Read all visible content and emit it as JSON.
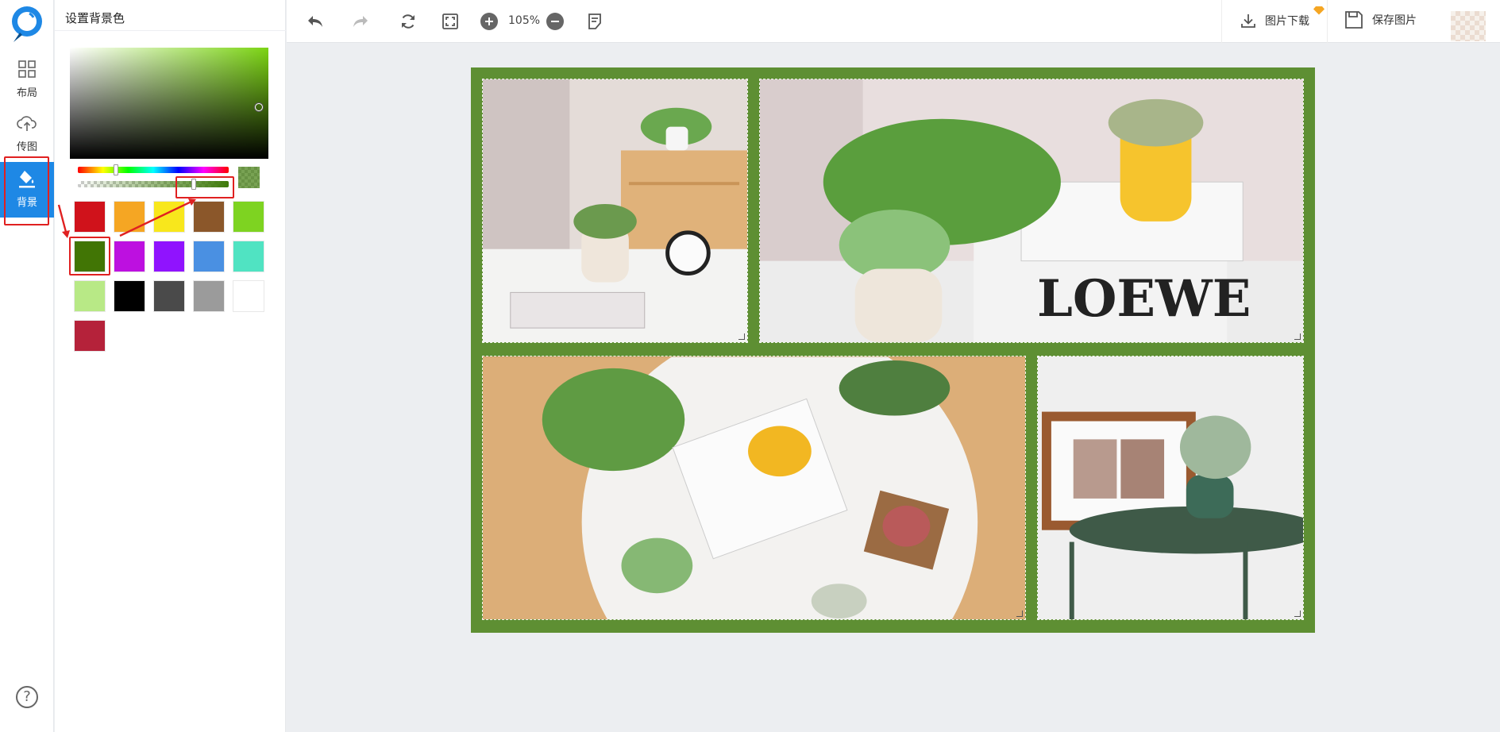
{
  "rail": {
    "items": [
      {
        "label": "布局",
        "icon": "layout-grid-icon"
      },
      {
        "label": "传图",
        "icon": "cloud-upload-icon"
      },
      {
        "label": "背景",
        "icon": "paint-bucket-icon",
        "active": true
      }
    ],
    "help_glyph": "?"
  },
  "panel": {
    "title": "设置背景色",
    "picker": {
      "current_color": "#3e7a0a",
      "hue_color": "#7cd414",
      "opacity_percent": 70
    },
    "swatches": [
      "#d0121b",
      "#f5a623",
      "#f8e71c",
      "#8b572a",
      "#7ed321",
      "#417505",
      "#bd10e0",
      "#9013fe",
      "#4a90e2",
      "#50e3c2",
      "#b8e986",
      "#000000",
      "#4a4a4a",
      "#9b9b9b",
      "#ffffff",
      "#b5223a"
    ],
    "selected_swatch": "#417505"
  },
  "toolbar": {
    "zoom": "105%",
    "download_label": "图片下载",
    "save_label": "保存图片"
  },
  "canvas": {
    "background": "#5e8f33",
    "photos": [
      {
        "name": "succulent-clock-table"
      },
      {
        "name": "succulent-yellow-pot-books"
      },
      {
        "name": "succulents-table-top-view"
      },
      {
        "name": "photo-frame-round-table"
      }
    ]
  }
}
